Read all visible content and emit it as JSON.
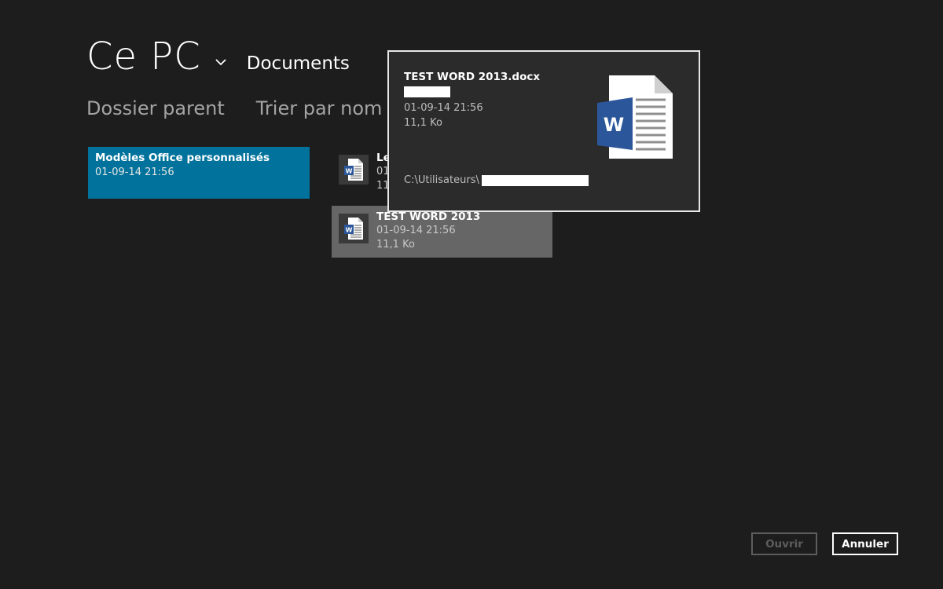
{
  "location": {
    "title": "Ce PC",
    "folder": "Documents"
  },
  "commands": {
    "parent_folder": "Dossier parent",
    "sort": "Trier par nom"
  },
  "items": [
    {
      "type": "folder",
      "name": "Modèles Office personnalisés",
      "date": "01-09-14 21:56"
    },
    {
      "type": "file",
      "name": "Le",
      "date": "01",
      "size": "11,"
    },
    {
      "type": "file",
      "name": "TEST WORD 2013",
      "date": "01-09-14 21:56",
      "size": "11,1 Ko",
      "selected": true
    }
  ],
  "tooltip": {
    "filename": "TEST WORD 2013.docx",
    "date": "01-09-14 21:56",
    "size": "11,1 Ko",
    "path_prefix": "C:\\Utilisateurs\\"
  },
  "buttons": {
    "open": "Ouvrir",
    "cancel": "Annuler"
  },
  "colors": {
    "background": "#1d1d1d",
    "folder_tile": "#00729b",
    "selected_item": "#666666",
    "word_blue": "#2b579a"
  },
  "icons": {
    "location_dropdown": "chevron-down-icon",
    "sort_dropdown": "chevron-down-icon",
    "file_type": "word-document-icon"
  }
}
